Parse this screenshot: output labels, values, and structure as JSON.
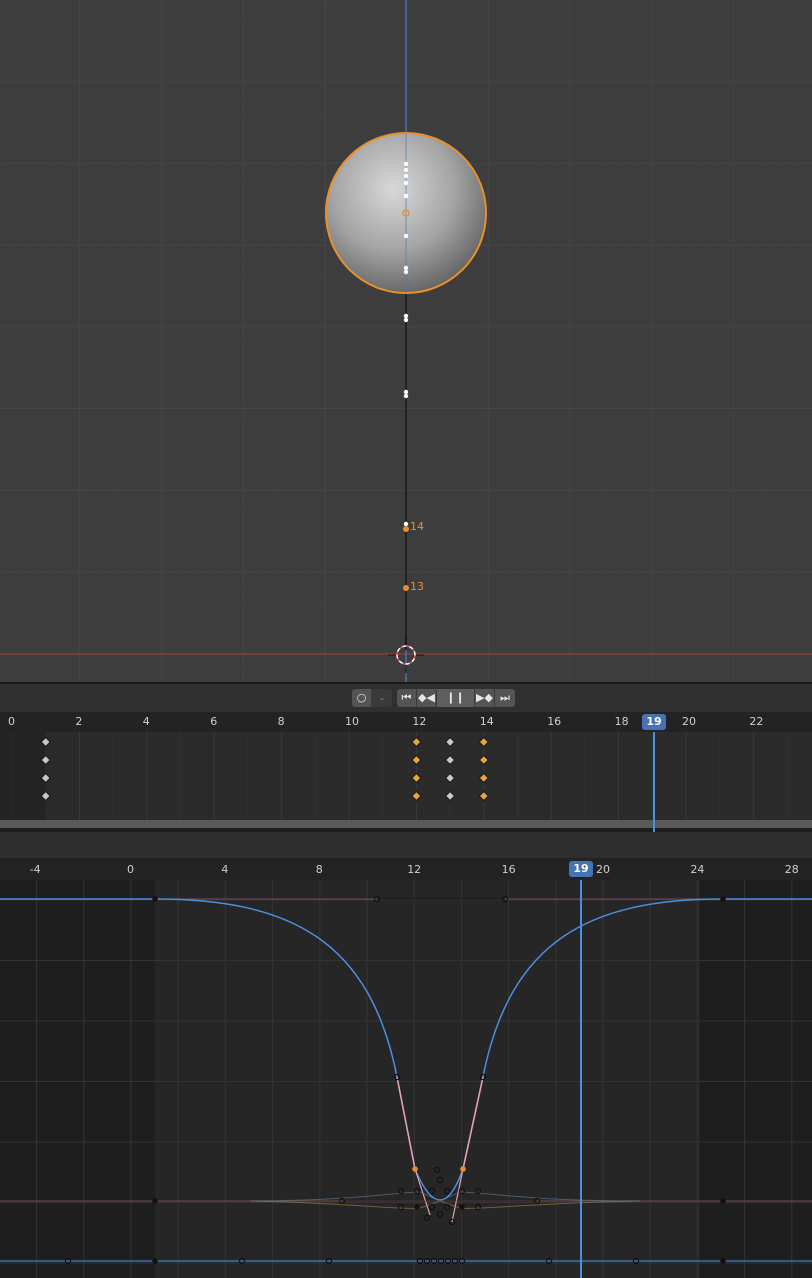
{
  "viewport": {
    "path_labels": [
      {
        "id": "label-14",
        "text": "14"
      },
      {
        "id": "label-13",
        "text": "13"
      }
    ]
  },
  "timeline": {
    "current_frame": "19",
    "ticks": [
      "0",
      "2",
      "4",
      "6",
      "8",
      "10",
      "12",
      "14",
      "16",
      "18",
      "20",
      "22"
    ],
    "playback_icons": [
      "record-icon",
      "dropdown-icon",
      "jump-start-icon",
      "prev-keyframe-icon",
      "pause-icon",
      "next-keyframe-icon",
      "jump-end-icon"
    ]
  },
  "graph_editor": {
    "current_frame": "19",
    "ticks": [
      "-4",
      "0",
      "4",
      "8",
      "12",
      "16",
      "20",
      "24",
      "28"
    ]
  },
  "colors": {
    "accent": "#4772b3",
    "selected": "#e8902a",
    "curve_blue": "#4b8fe0",
    "curve_pink": "#e8a0b0",
    "viewport_bg": "#3d3d3d"
  }
}
